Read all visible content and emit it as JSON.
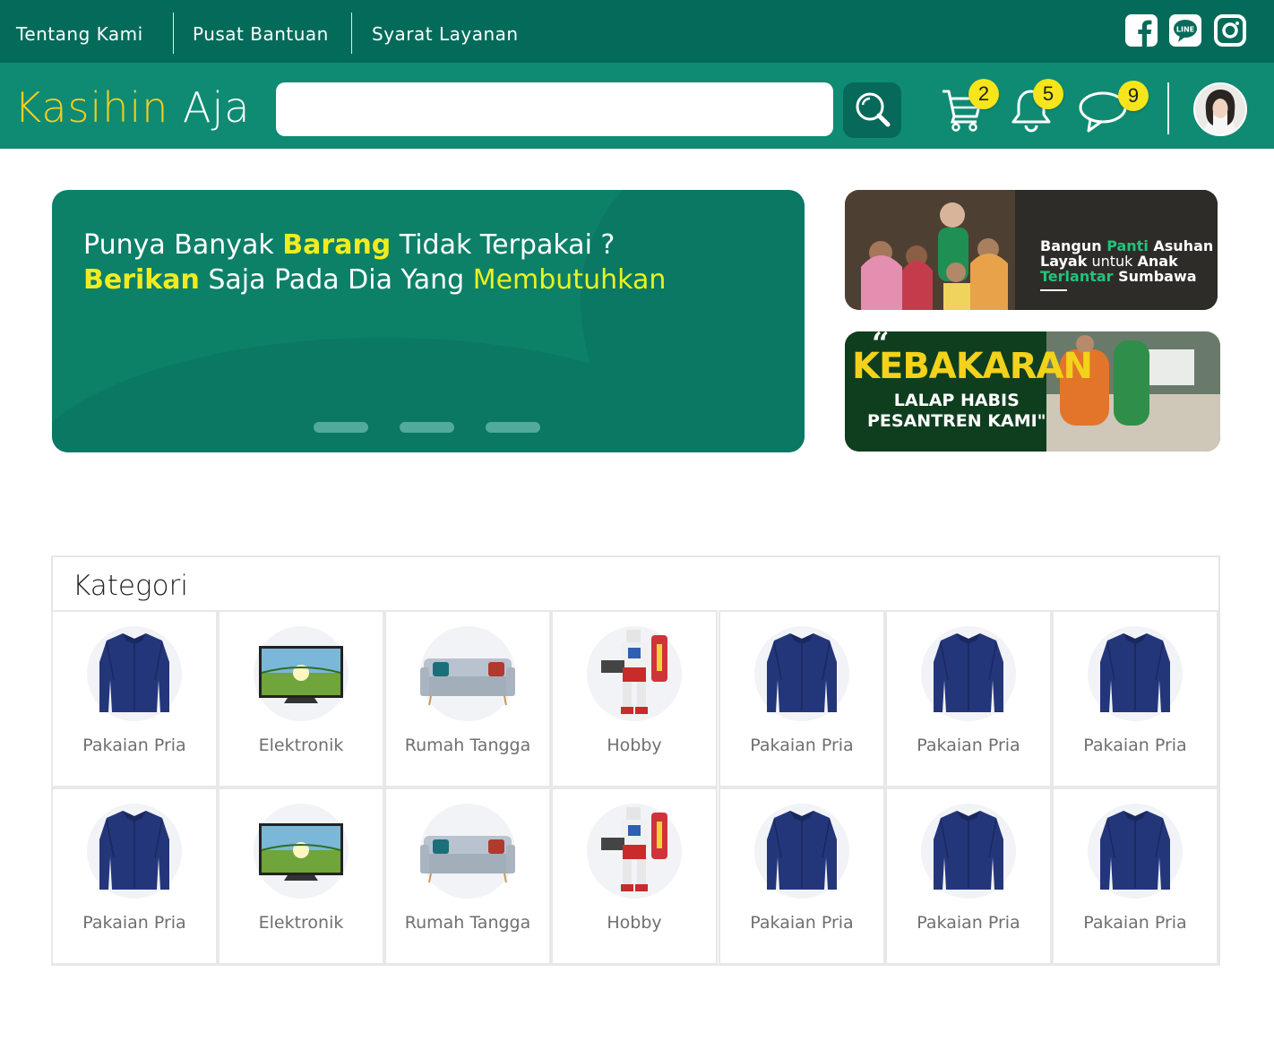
{
  "topbar": {
    "links": [
      "Tentang Kami",
      "Pusat Bantuan",
      "Syarat Layanan"
    ],
    "social": [
      "facebook-icon",
      "line-icon",
      "instagram-icon"
    ],
    "line_label": "LINE"
  },
  "header": {
    "logo_part1": "Kasihin",
    "logo_part2": "Aja",
    "search_placeholder": "",
    "cart_count": "2",
    "notif_count": "5",
    "message_count": "9"
  },
  "hero": {
    "line1_a": "Punya Banyak ",
    "line1_b": "Barang",
    "line1_c": " Tidak Terpakai ?",
    "line2_a": "Berikan",
    "line2_b": " Saja Pada Dia Yang ",
    "line2_c": "Membutuhkan",
    "slides": 3
  },
  "side_banner_1": {
    "t1": "Bangun ",
    "t2": "Panti",
    "t3": " Asuhan",
    "t4": "Layak",
    "t5": " untuk ",
    "t6": "Anak",
    "t7": "Terlantar",
    "t8": " Sumbawa"
  },
  "side_banner_2": {
    "quote": "“",
    "title": "KEBAKARAN",
    "line1": "LALAP HABIS",
    "line2": "PESANTREN KAMI\""
  },
  "categories": {
    "title": "Kategori",
    "items": [
      {
        "label": "Pakaian Pria",
        "icon": "shirt-icon"
      },
      {
        "label": "Elektronik",
        "icon": "tv-icon"
      },
      {
        "label": "Rumah Tangga",
        "icon": "sofa-icon"
      },
      {
        "label": "Hobby",
        "icon": "robot-toy-icon"
      },
      {
        "label": "Pakaian Pria",
        "icon": "shirt-icon"
      },
      {
        "label": "Pakaian Pria",
        "icon": "shirt-icon"
      },
      {
        "label": "Pakaian Pria",
        "icon": "shirt-icon"
      },
      {
        "label": "Pakaian Pria",
        "icon": "shirt-icon"
      },
      {
        "label": "Elektronik",
        "icon": "tv-icon"
      },
      {
        "label": "Rumah Tangga",
        "icon": "sofa-icon"
      },
      {
        "label": "Hobby",
        "icon": "robot-toy-icon"
      },
      {
        "label": "Pakaian Pria",
        "icon": "shirt-icon"
      },
      {
        "label": "Pakaian Pria",
        "icon": "shirt-icon"
      },
      {
        "label": "Pakaian Pria",
        "icon": "shirt-icon"
      }
    ]
  },
  "colors": {
    "topbar": "#046b5a",
    "header": "#0f8b73",
    "accent_yellow": "#f6cf1d",
    "badge": "#f5e51a"
  }
}
